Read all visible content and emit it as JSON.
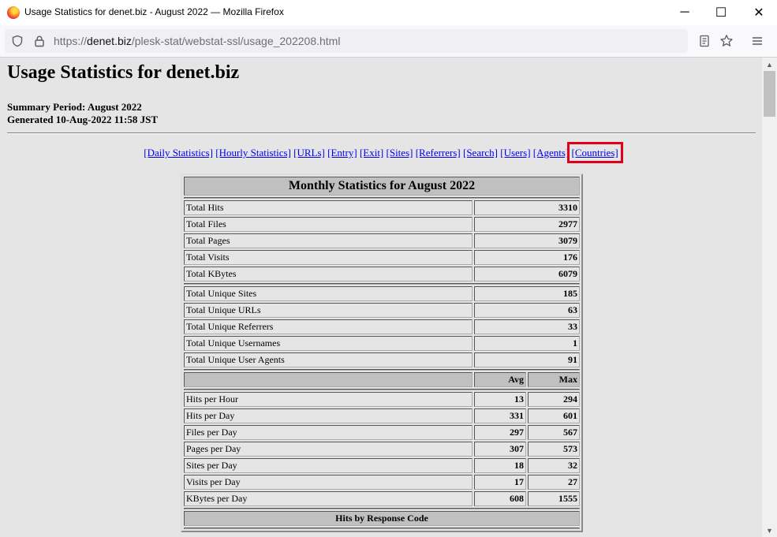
{
  "window": {
    "title": "Usage Statistics for denet.biz - August 2022 — Mozilla Firefox",
    "minimize": "─",
    "maximize": "☐",
    "close": "✕"
  },
  "urlbar": {
    "prefix": "https://",
    "domain": "denet.biz",
    "path": "/plesk-stat/webstat-ssl/usage_202208.html"
  },
  "page": {
    "heading": "Usage Statistics for denet.biz",
    "summary_period": "Summary Period: August 2022",
    "generated": "Generated 10-Aug-2022 11:58 JST",
    "nav_links": [
      "[Daily Statistics]",
      "[Hourly Statistics]",
      "[URLs]",
      "[Entry]",
      "[Exit]",
      "[Sites]",
      "[Referrers]",
      "[Search]",
      "[Users]",
      "[Agents]",
      "[Countries]"
    ]
  },
  "monthly": {
    "title": "Monthly Statistics for August 2022",
    "totals": [
      {
        "label": "Total Hits",
        "value": "3310"
      },
      {
        "label": "Total Files",
        "value": "2977"
      },
      {
        "label": "Total Pages",
        "value": "3079"
      },
      {
        "label": "Total Visits",
        "value": "176"
      },
      {
        "label": "Total KBytes",
        "value": "6079"
      }
    ],
    "uniques": [
      {
        "label": "Total Unique Sites",
        "value": "185"
      },
      {
        "label": "Total Unique URLs",
        "value": "63"
      },
      {
        "label": "Total Unique Referrers",
        "value": "33"
      },
      {
        "label": "Total Unique Usernames",
        "value": "1"
      },
      {
        "label": "Total Unique User Agents",
        "value": "91"
      }
    ],
    "avg_label": "Avg",
    "max_label": "Max",
    "rates": [
      {
        "label": "Hits per Hour",
        "avg": "13",
        "max": "294"
      },
      {
        "label": "Hits per Day",
        "avg": "331",
        "max": "601"
      },
      {
        "label": "Files per Day",
        "avg": "297",
        "max": "567"
      },
      {
        "label": "Pages per Day",
        "avg": "307",
        "max": "573"
      },
      {
        "label": "Sites per Day",
        "avg": "18",
        "max": "32"
      },
      {
        "label": "Visits per Day",
        "avg": "17",
        "max": "27"
      },
      {
        "label": "KBytes per Day",
        "avg": "608",
        "max": "1555"
      }
    ],
    "response_title": "Hits by Response Code"
  }
}
